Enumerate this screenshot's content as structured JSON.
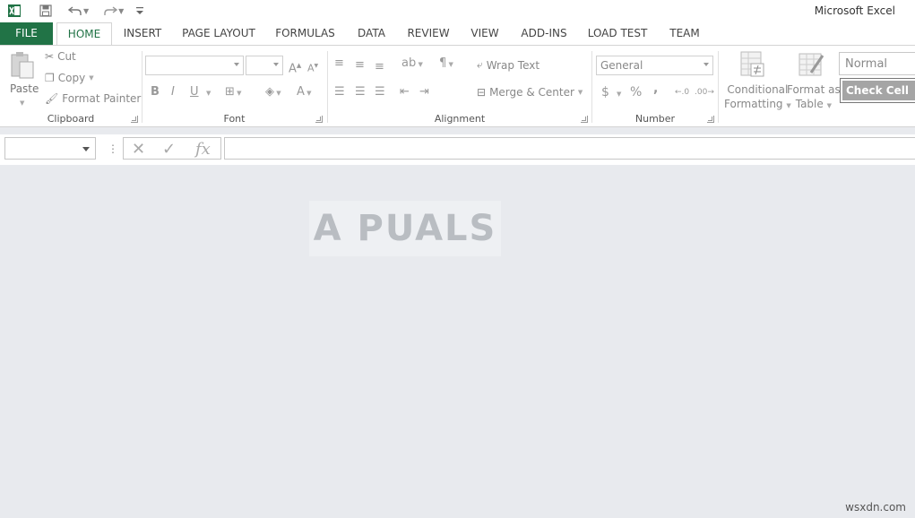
{
  "window": {
    "title": "Microsoft Excel"
  },
  "tabs": [
    {
      "label": "FILE"
    },
    {
      "label": "HOME"
    },
    {
      "label": "INSERT"
    },
    {
      "label": "PAGE LAYOUT"
    },
    {
      "label": "FORMULAS"
    },
    {
      "label": "DATA"
    },
    {
      "label": "REVIEW"
    },
    {
      "label": "VIEW"
    },
    {
      "label": "ADD-INS"
    },
    {
      "label": "LOAD TEST"
    },
    {
      "label": "TEAM"
    }
  ],
  "ribbon": {
    "clipboard": {
      "label": "Clipboard",
      "paste": "Paste",
      "cut": "Cut",
      "copy": "Copy",
      "format_painter": "Format Painter"
    },
    "font": {
      "label": "Font",
      "bold": "B",
      "italic": "I",
      "underline": "U"
    },
    "alignment": {
      "label": "Alignment",
      "wrap_text": "Wrap Text",
      "merge_center": "Merge & Center"
    },
    "number": {
      "label": "Number",
      "format": "General",
      "currency": "$",
      "percent": "%",
      "comma": ","
    },
    "styles": {
      "conditional_1": "Conditional",
      "conditional_2": "Formatting",
      "format_table_1": "Format as",
      "format_table_2": "Table",
      "normal": "Normal",
      "check_cell": "Check Cell"
    }
  },
  "formula_bar": {
    "fx": "fx"
  },
  "watermark": {
    "text": "A PUALS"
  },
  "credit": "wsxdn.com",
  "colors": {
    "accent": "#217346"
  }
}
